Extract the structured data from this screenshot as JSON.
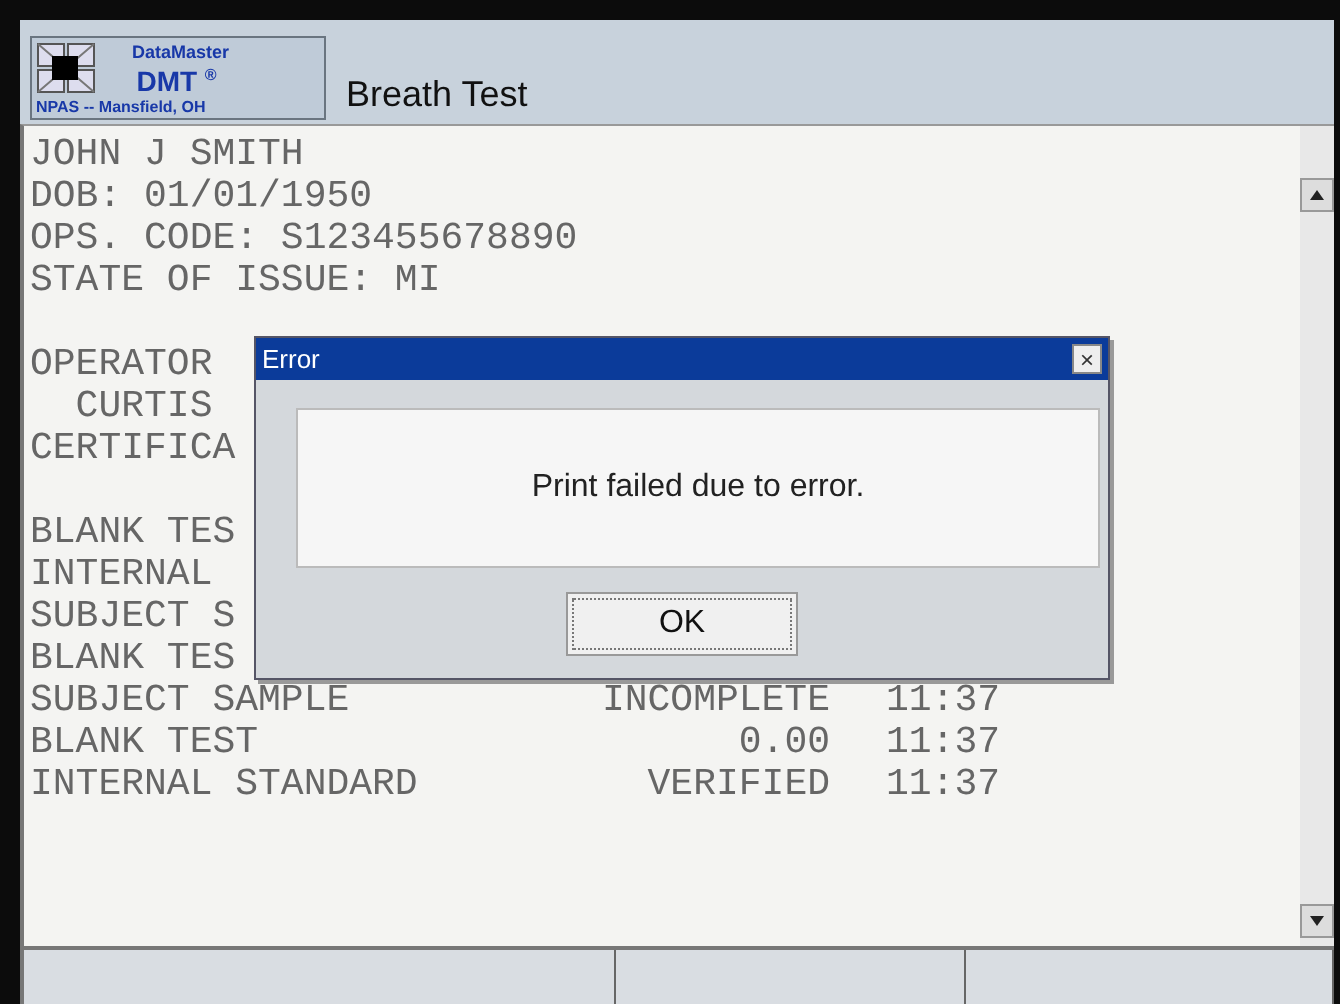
{
  "header": {
    "logo": {
      "brand": "DataMaster",
      "model": "DMT",
      "mark": "®",
      "location": "NPAS -- Mansfield, OH"
    },
    "title": "Breath Test"
  },
  "report": {
    "lines": [
      {
        "kind": "text",
        "label": "JOHN J SMITH"
      },
      {
        "kind": "text",
        "label": "DOB: 01/01/1950"
      },
      {
        "kind": "text",
        "label": "OPS. CODE: S123455678890"
      },
      {
        "kind": "text",
        "label": "STATE OF ISSUE: MI"
      },
      {
        "kind": "blank"
      },
      {
        "kind": "text",
        "label": "OPERATOR"
      },
      {
        "kind": "text",
        "label": "  CURTIS"
      },
      {
        "kind": "text",
        "label": "CERTIFICA"
      },
      {
        "kind": "blank"
      },
      {
        "kind": "text",
        "label": "BLANK TES"
      },
      {
        "kind": "text",
        "label": "INTERNAL"
      },
      {
        "kind": "text",
        "label": "SUBJECT S"
      },
      {
        "kind": "text",
        "label": "BLANK TES"
      },
      {
        "kind": "text",
        "label": "SUBJECT SAMPLE",
        "value": "INCOMPLETE",
        "time": "11:37"
      },
      {
        "kind": "text",
        "label": "BLANK TEST",
        "value": "0.00",
        "time": "11:37"
      },
      {
        "kind": "text",
        "label": "INTERNAL STANDARD",
        "value": "VERIFIED",
        "time": "11:37"
      }
    ]
  },
  "dialog": {
    "title": "Error",
    "close": "×",
    "message": "Print failed due to error.",
    "button": "OK"
  }
}
